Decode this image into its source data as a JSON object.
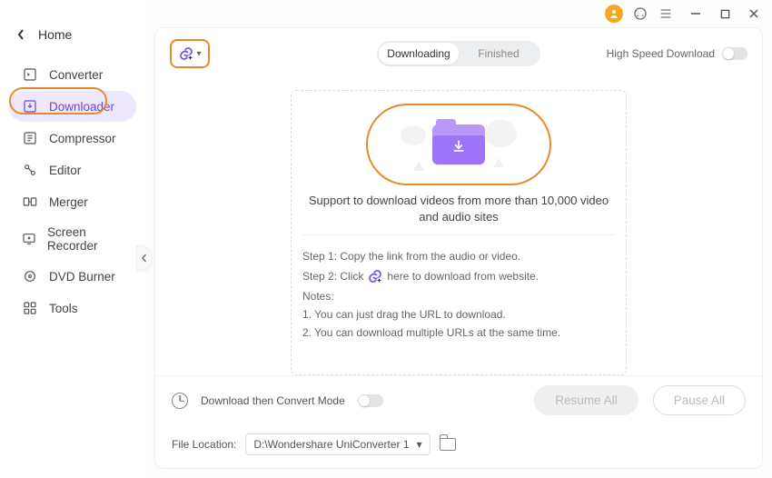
{
  "titlebar": {
    "avatar_alt": "user-avatar"
  },
  "sidebar": {
    "home_label": "Home",
    "items": [
      {
        "label": "Converter",
        "icon": "converter-icon"
      },
      {
        "label": "Downloader",
        "icon": "downloader-icon"
      },
      {
        "label": "Compressor",
        "icon": "compressor-icon"
      },
      {
        "label": "Editor",
        "icon": "editor-icon"
      },
      {
        "label": "Merger",
        "icon": "merger-icon"
      },
      {
        "label": "Screen Recorder",
        "icon": "screen-recorder-icon"
      },
      {
        "label": "DVD Burner",
        "icon": "dvd-burner-icon"
      },
      {
        "label": "Tools",
        "icon": "tools-icon"
      }
    ]
  },
  "topbar": {
    "tabs": {
      "downloading": "Downloading",
      "finished": "Finished"
    },
    "high_speed_label": "High Speed Download"
  },
  "panel": {
    "support_text": "Support to download videos from more than 10,000 video and audio sites",
    "step1": "Step 1: Copy the link from the audio or video.",
    "step2_a": "Step 2: Click",
    "step2_b": "here to download from website.",
    "notes_heading": "Notes:",
    "note1": "1. You can just drag the URL to download.",
    "note2": "2. You can download multiple URLs at the same time."
  },
  "bottombar": {
    "convert_mode_label": "Download then Convert Mode",
    "file_location_label": "File Location:",
    "file_location_value": "D:\\Wondershare UniConverter 1",
    "resume_label": "Resume All",
    "pause_label": "Pause All"
  }
}
